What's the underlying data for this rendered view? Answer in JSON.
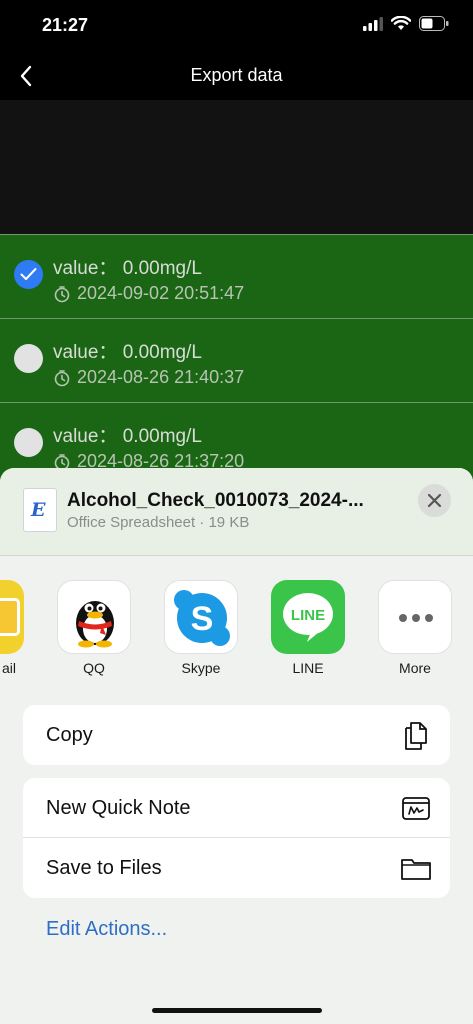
{
  "status": {
    "time": "21:27"
  },
  "nav": {
    "title": "Export data"
  },
  "records": [
    {
      "value_label": "value：",
      "value": "0.00mg/L",
      "timestamp": "2024-09-02 20:51:47",
      "checked": true
    },
    {
      "value_label": "value：",
      "value": "0.00mg/L",
      "timestamp": "2024-08-26 21:40:37",
      "checked": false
    },
    {
      "value_label": "value：",
      "value": "0.00mg/L",
      "timestamp": "2024-08-26 21:37:20",
      "checked": false
    }
  ],
  "share_sheet": {
    "file_name": "Alcohol_Check_0010073_2024-...",
    "file_type": "Office Spreadsheet",
    "file_size": "19 KB",
    "file_meta": "Office Spreadsheet · 19 KB",
    "file_icon_letter": "E",
    "apps": [
      {
        "label": "ail",
        "icon": "mail-icon"
      },
      {
        "label": "QQ",
        "icon": "qq-icon"
      },
      {
        "label": "Skype",
        "icon": "skype-icon"
      },
      {
        "label": "LINE",
        "icon": "line-icon"
      },
      {
        "label": "More",
        "icon": "more-icon"
      }
    ],
    "skype_letter": "S",
    "line_text": "LINE",
    "actions_group1": [
      {
        "label": "Copy",
        "icon": "copy-icon"
      }
    ],
    "actions_group2": [
      {
        "label": "New Quick Note",
        "icon": "quick-note-icon"
      },
      {
        "label": "Save to Files",
        "icon": "folder-icon"
      }
    ],
    "edit_actions": "Edit Actions..."
  },
  "colors": {
    "list_bg": "#1b6614",
    "accent_blue": "#2e7bf4",
    "link_blue": "#2f6ec6"
  }
}
